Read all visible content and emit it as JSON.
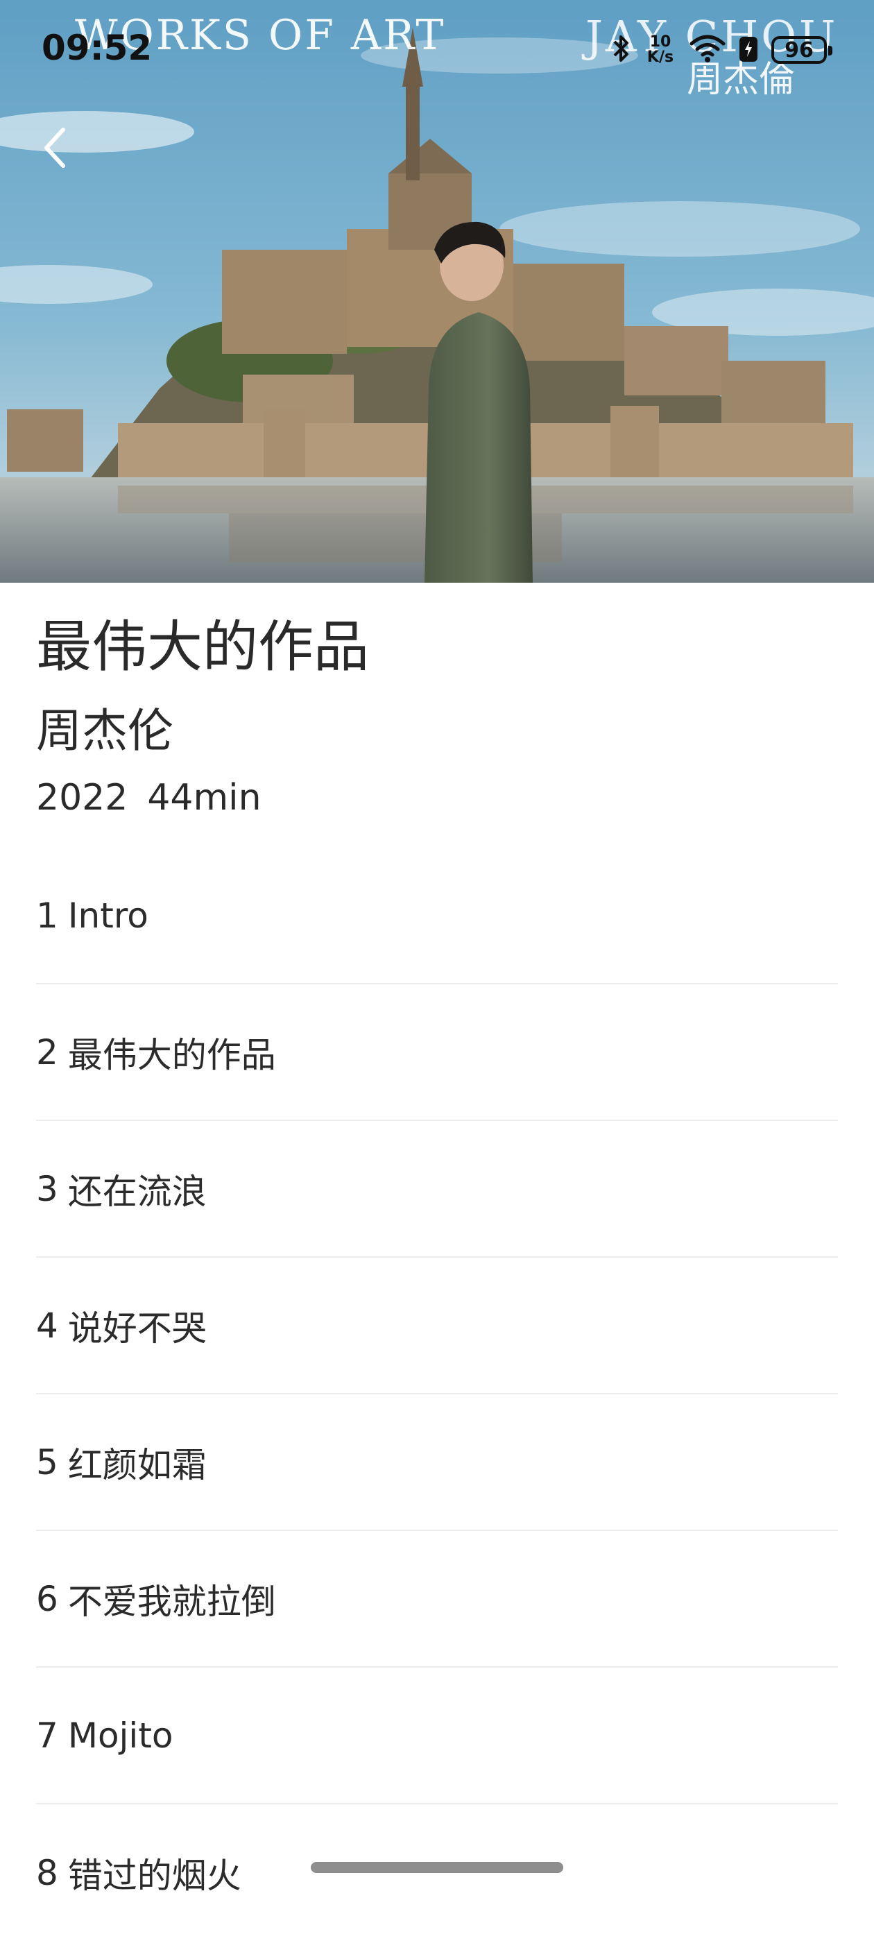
{
  "status_bar": {
    "time": "09:52",
    "net_speed_value": "10",
    "net_speed_unit": "K/s",
    "battery": "96",
    "icons": [
      "bluetooth-icon",
      "wifi-icon",
      "battery-saver-icon",
      "battery-icon"
    ]
  },
  "cover": {
    "text_left": "WORKS OF ART",
    "text_right": "JAY CHOU",
    "text_right_cn": "周杰倫",
    "colors": {
      "sky": "#6aa8c8",
      "castle": "#9c8466",
      "water": "#8a9296"
    }
  },
  "nav": {
    "back_icon": "chevron-left-icon"
  },
  "album": {
    "title": "最伟大的作品",
    "artist": "周杰伦",
    "year": "2022",
    "duration": "44min"
  },
  "tracks": [
    {
      "num": "1",
      "title": "Intro"
    },
    {
      "num": "2",
      "title": "最伟大的作品"
    },
    {
      "num": "3",
      "title": "还在流浪"
    },
    {
      "num": "4",
      "title": "说好不哭"
    },
    {
      "num": "5",
      "title": "红颜如霜"
    },
    {
      "num": "6",
      "title": "不爱我就拉倒"
    },
    {
      "num": "7",
      "title": "Mojito"
    },
    {
      "num": "8",
      "title": "错过的烟火"
    }
  ]
}
